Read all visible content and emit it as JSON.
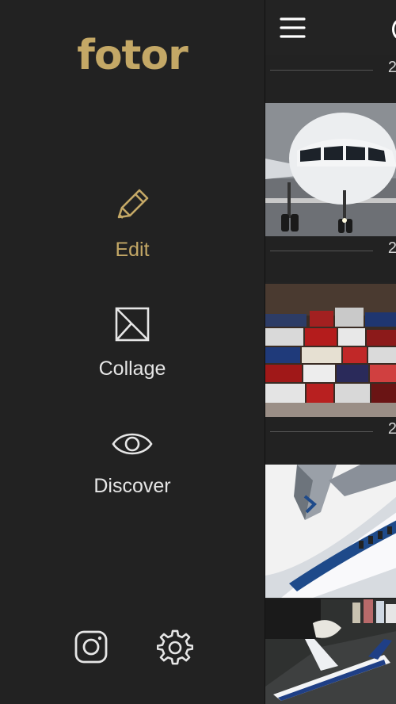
{
  "app": {
    "logo": "fotor"
  },
  "menu": {
    "edit": {
      "label": "Edit",
      "icon": "pencil-icon"
    },
    "collage": {
      "label": "Collage",
      "icon": "collage-icon"
    },
    "discover": {
      "label": "Discover",
      "icon": "eye-icon"
    }
  },
  "bottom": {
    "instagram_icon": "instagram-icon",
    "settings_icon": "gear-icon"
  },
  "feed": {
    "date_rows": [
      {
        "label": "2"
      },
      {
        "label": "2"
      },
      {
        "label": "2"
      }
    ],
    "photos": [
      {
        "subject": "airliner-front-photo"
      },
      {
        "subject": "model-kit-boxes-photo"
      },
      {
        "subject": "airliner-model-fuselage-photo"
      },
      {
        "subject": "lan-airliner-model-photo"
      }
    ]
  },
  "colors": {
    "accent": "#c4a866",
    "background": "#222222"
  }
}
